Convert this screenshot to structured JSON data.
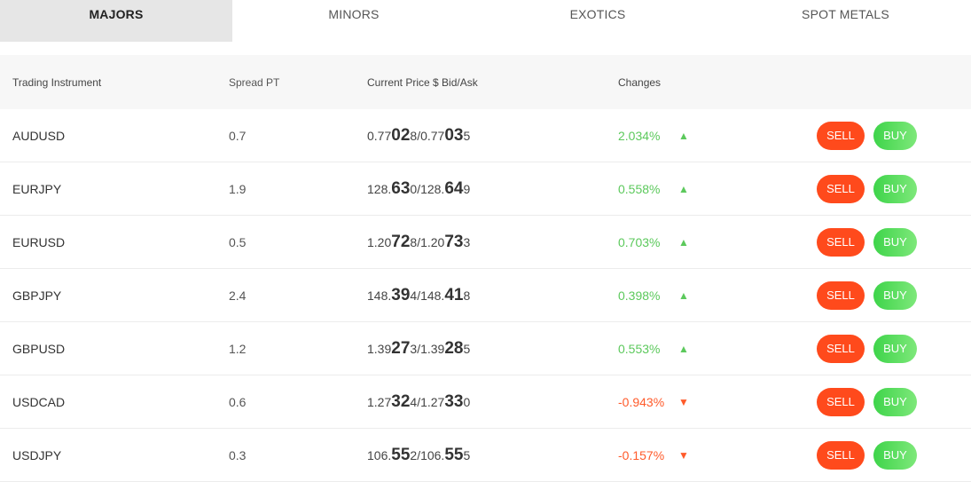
{
  "tabs": [
    {
      "label": "MAJORS",
      "active": true
    },
    {
      "label": "MINORS",
      "active": false
    },
    {
      "label": "EXOTICS",
      "active": false
    },
    {
      "label": "SPOT METALS",
      "active": false
    }
  ],
  "columns": {
    "instrument": "Trading Instrument",
    "spread": "Spread PT",
    "price": "Current Price $ Bid/Ask",
    "changes": "Changes"
  },
  "buttons": {
    "sell": "SELL",
    "buy": "BUY"
  },
  "colors": {
    "up": "#5cc95c",
    "down": "#ff5a2a",
    "sell": "#ff4a1c",
    "buy": "#3ed44a"
  },
  "rows": [
    {
      "instrument": "AUDUSD",
      "spread": "0.7",
      "bid": [
        "0.77",
        "02",
        "8"
      ],
      "ask": [
        "0.77",
        "03",
        "5"
      ],
      "change": "2.034%",
      "direction": "up",
      "arrow": "▲"
    },
    {
      "instrument": "EURJPY",
      "spread": "1.9",
      "bid": [
        "128.",
        "63",
        "0"
      ],
      "ask": [
        "128.",
        "64",
        "9"
      ],
      "change": "0.558%",
      "direction": "up",
      "arrow": "▲"
    },
    {
      "instrument": "EURUSD",
      "spread": "0.5",
      "bid": [
        "1.20",
        "72",
        "8"
      ],
      "ask": [
        "1.20",
        "73",
        "3"
      ],
      "change": "0.703%",
      "direction": "up",
      "arrow": "▲"
    },
    {
      "instrument": "GBPJPY",
      "spread": "2.4",
      "bid": [
        "148.",
        "39",
        "4"
      ],
      "ask": [
        "148.",
        "41",
        "8"
      ],
      "change": "0.398%",
      "direction": "up",
      "arrow": "▲"
    },
    {
      "instrument": "GBPUSD",
      "spread": "1.2",
      "bid": [
        "1.39",
        "27",
        "3"
      ],
      "ask": [
        "1.39",
        "28",
        "5"
      ],
      "change": "0.553%",
      "direction": "up",
      "arrow": "▲"
    },
    {
      "instrument": "USDCAD",
      "spread": "0.6",
      "bid": [
        "1.27",
        "32",
        "4"
      ],
      "ask": [
        "1.27",
        "33",
        "0"
      ],
      "change": "-0.943%",
      "direction": "down",
      "arrow": "▼"
    },
    {
      "instrument": "USDJPY",
      "spread": "0.3",
      "bid": [
        "106.",
        "55",
        "2"
      ],
      "ask": [
        "106.",
        "55",
        "5"
      ],
      "change": "-0.157%",
      "direction": "down",
      "arrow": "▼"
    }
  ]
}
